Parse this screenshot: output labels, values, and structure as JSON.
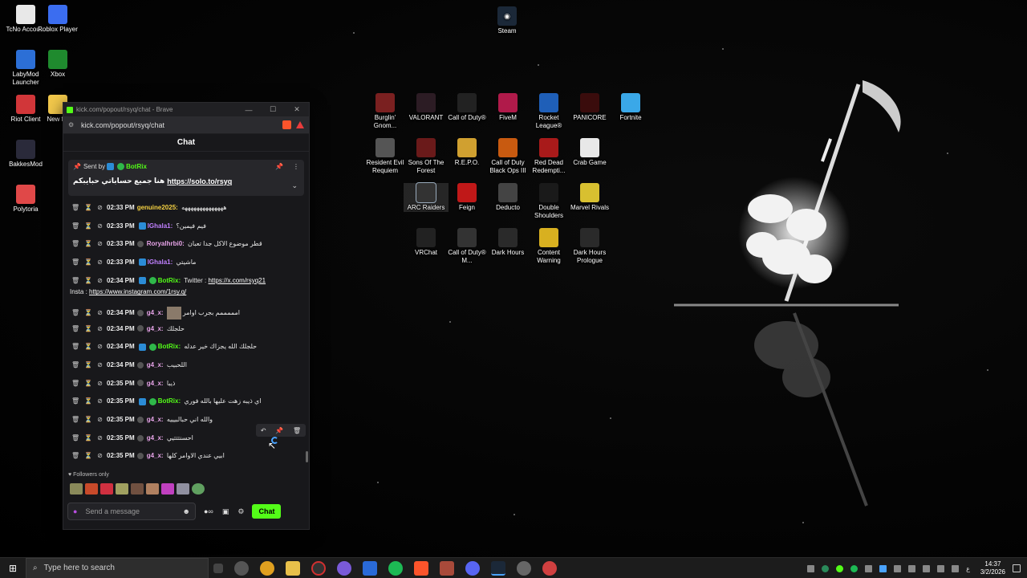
{
  "desktop": {
    "icons_left": [
      {
        "label": "TcNo Accou...",
        "color": "#e8e8e8"
      },
      {
        "label": "Roblox Player",
        "color": "#3b6df0"
      },
      {
        "label": "LabyMod Launcher",
        "color": "#2c6fd6"
      },
      {
        "label": "Xbox",
        "color": "#1f8a2e"
      },
      {
        "label": "Riot Client",
        "color": "#d13639"
      },
      {
        "label": "New f...",
        "color": "#f2c84b"
      },
      {
        "label": "BakkesMod",
        "color": "#2a2a3a"
      },
      {
        "label": "Polytoria",
        "color": "#e04848"
      }
    ],
    "steam": {
      "label": "Steam",
      "color": "#1b2838"
    },
    "icons_grid": [
      {
        "label": "Burglin' Gnom...",
        "color": "#7a2020"
      },
      {
        "label": "VALORANT",
        "color": "#2c1c24"
      },
      {
        "label": "Call of Duty®",
        "color": "#222"
      },
      {
        "label": "FiveM",
        "color": "#b01a4a"
      },
      {
        "label": "Rocket League®",
        "color": "#1f5fb8"
      },
      {
        "label": "PANICORE",
        "color": "#3a0c0c"
      },
      {
        "label": "Fortnite",
        "color": "#3aa8e8"
      },
      {
        "label": "Resident Evil Requiem",
        "color": "#555"
      },
      {
        "label": "Sons Of The Forest",
        "color": "#6a1a1a"
      },
      {
        "label": "R.E.P.O.",
        "color": "#d0a030"
      },
      {
        "label": "Call of Duty Black Ops III",
        "color": "#c85a10"
      },
      {
        "label": "Red Dead Redempti...",
        "color": "#a81a1a"
      },
      {
        "label": "Crab Game",
        "color": "#e8e8e8"
      },
      {
        "label": "ARC Raiders",
        "color": "#333"
      },
      {
        "label": "Feign",
        "color": "#c01818"
      },
      {
        "label": "Deducto",
        "color": "#444"
      },
      {
        "label": "Double Shoulders",
        "color": "#1a1a1a"
      },
      {
        "label": "Marvel Rivals",
        "color": "#d8c030"
      },
      {
        "label": "VRChat",
        "color": "#222"
      },
      {
        "label": "Call of Duty® M...",
        "color": "#333"
      },
      {
        "label": "Dark Hours",
        "color": "#2a2a2a"
      },
      {
        "label": "Content Warning",
        "color": "#d8b020"
      },
      {
        "label": "Dark Hours Prologue",
        "color": "#2a2a2a"
      }
    ]
  },
  "browser": {
    "window_title": "kick.com/popout/rsyq/chat - Brave",
    "url": "kick.com/popout/rsyq/chat",
    "controls": {
      "minimize": "—",
      "maximize": "☐",
      "close": "✕"
    }
  },
  "chat": {
    "header": "Chat",
    "pinned": {
      "prefix": "Sent by",
      "user": "BotRix",
      "text": "هنا جميع حساباتي حبايبكم",
      "link": "https://solo.to/rsyq"
    },
    "messages": [
      {
        "time": "02:33 PM",
        "user": "genuine2025:",
        "user_color": "yellow",
        "text": "ههههههههههههههه"
      },
      {
        "time": "02:33 PM",
        "user": "lGhala1:",
        "user_color": "purple",
        "text": "فيم فيمين؟"
      },
      {
        "time": "02:33 PM",
        "user": "Roryalhrbi0:",
        "user_color": "pink",
        "text": "قطر موضوع الاكل جدا تعبان"
      },
      {
        "time": "02:33 PM",
        "user": "lGhala1:",
        "user_color": "purple",
        "text": "ماشيتي"
      },
      {
        "time": "02:34 PM",
        "user": "BotRix:",
        "user_color": "green",
        "text": "Twitter :",
        "link": "https://x.com/rsyq21",
        "cont_label": "Insta :",
        "cont_link": "https://www.instagram.com/1rsy.q/"
      },
      {
        "time": "02:34 PM",
        "user": "g4_x:",
        "user_color": "pink",
        "text": "امممممم بجرب اوامر"
      },
      {
        "time": "02:34 PM",
        "user": "g4_x:",
        "user_color": "pink",
        "text": "حلجلك"
      },
      {
        "time": "02:34 PM",
        "user": "BotRix:",
        "user_color": "green",
        "text": "حلجلك الله يجزاك خير عدله"
      },
      {
        "time": "02:34 PM",
        "user": "g4_x:",
        "user_color": "pink",
        "text": "اللحبيب"
      },
      {
        "time": "02:35 PM",
        "user": "g4_x:",
        "user_color": "pink",
        "text": "ذيبا"
      },
      {
        "time": "02:35 PM",
        "user": "BotRix:",
        "user_color": "green",
        "text": "اي ذيبه زهت عليها بالله فوري"
      },
      {
        "time": "02:35 PM",
        "user": "g4_x:",
        "user_color": "pink",
        "text": "والله اني حبالبيييه"
      },
      {
        "time": "02:35 PM",
        "user": "g4_x:",
        "user_color": "pink",
        "text": "احسنتتتيي"
      },
      {
        "time": "02:35 PM",
        "user": "g4_x:",
        "user_color": "pink",
        "text": "ابيي عندي الاوامر كلها"
      }
    ],
    "followers_only": "Followers only",
    "composer_placeholder": "Send a message",
    "chat_button": "Chat"
  },
  "taskbar": {
    "search_placeholder": "Type here to search",
    "time": "14:37",
    "date": "3/2/2026",
    "lang": "ع"
  }
}
